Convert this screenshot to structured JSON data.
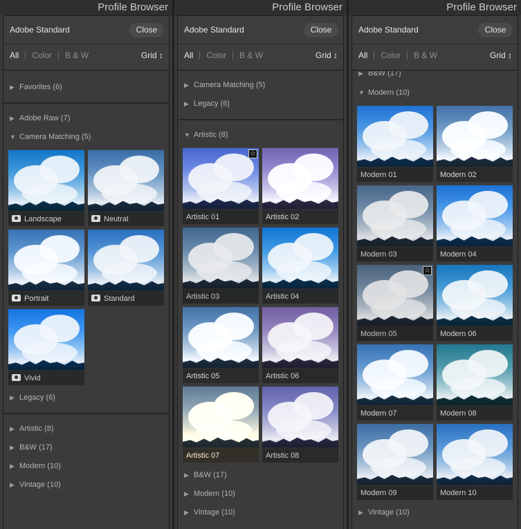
{
  "panels": [
    {
      "title": "Profile Browser",
      "profile": "Adobe Standard",
      "close": "Close",
      "filters": [
        "All",
        "Color",
        "B & W"
      ],
      "grid": "Grid ↕",
      "rows": {
        "favorites": "Favorites (6)",
        "adobe_raw": "Adobe Raw (7)",
        "camera_matching": "Camera Matching (5)",
        "legacy": "Legacy (6)",
        "artistic": "Artistic (8)",
        "bw": "B&W (17)",
        "modern": "Modern (10)",
        "vintage": "Vintage (10)"
      },
      "thumbs": [
        "Landscape",
        "Neutral",
        "Portrait",
        "Standard",
        "Vivid"
      ]
    },
    {
      "title": "Profile Browser",
      "profile": "Adobe Standard",
      "close": "Close",
      "filters": [
        "All",
        "Color",
        "B & W"
      ],
      "grid": "Grid ↕",
      "rows": {
        "camera_matching": "Camera Matching (5)",
        "legacy": "Legacy (6)",
        "artistic": "Artistic (8)",
        "bw": "B&W (17)",
        "modern": "Modern (10)",
        "vintage": "Vintage (10)"
      },
      "thumbs": [
        "Artistic 01",
        "Artistic 02",
        "Artistic 03",
        "Artistic 04",
        "Artistic 05",
        "Artistic 06",
        "Artistic 07",
        "Artistic 08"
      ]
    },
    {
      "title": "Profile Browser",
      "profile": "Adobe Standard",
      "close": "Close",
      "filters": [
        "All",
        "Color",
        "B & W"
      ],
      "grid": "Grid ↕",
      "rows": {
        "bw": "B&W (17)",
        "modern": "Modern (10)",
        "vintage": "Vintage (10)"
      },
      "thumbs": [
        "Modern 01",
        "Modern 02",
        "Modern 03",
        "Modern 04",
        "Modern 05",
        "Modern 06",
        "Modern 07",
        "Modern 08",
        "Modern 09",
        "Modern 10"
      ]
    }
  ],
  "icons": {
    "expanded": "▼",
    "collapsed": "▶",
    "star": "☆"
  }
}
